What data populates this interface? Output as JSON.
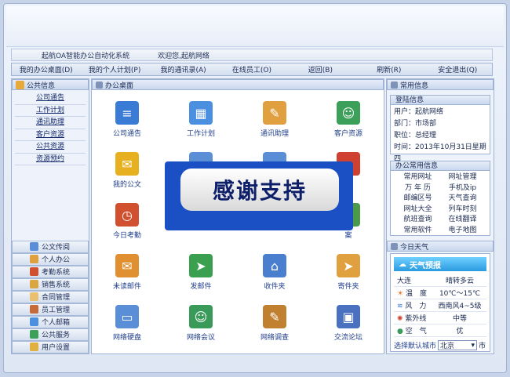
{
  "header": {
    "system_name": "起航OA智能办公自动化系统",
    "welcome": "欢迎您,起航网络"
  },
  "nav": [
    "我的办公桌面(D)",
    "我的个人计划(P)",
    "我的通讯录(A)",
    "在线员工(O)",
    "返回(B)",
    "刷新(R)",
    "安全退出(Q)"
  ],
  "left": {
    "title": "公共信息",
    "links": [
      "公司通告",
      "工作计划",
      "通讯助理",
      "客户资源",
      "公共资源",
      "资源预约"
    ],
    "modules": [
      "公文传阅",
      "个人办公",
      "考勤系统",
      "销售系统",
      "合同管理",
      "员工管理",
      "个人邮箱",
      "公共服务",
      "用户设置"
    ]
  },
  "main": {
    "title": "办公桌面",
    "icons": [
      {
        "label": "公司通告",
        "color": "#3a7bd5",
        "glyph": "≡"
      },
      {
        "label": "工作计划",
        "color": "#4a8fe0",
        "glyph": "▦"
      },
      {
        "label": "通讯助理",
        "color": "#e0a040",
        "glyph": "✎"
      },
      {
        "label": "客户资源",
        "color": "#3ca05a",
        "glyph": "☺"
      },
      {
        "label": "我的公文",
        "color": "#e6b020",
        "glyph": "✉"
      },
      {
        "label": "",
        "color": "#5a8fd8",
        "glyph": ""
      },
      {
        "label": "",
        "color": "#5a8fd8",
        "glyph": ""
      },
      {
        "label": "约",
        "color": "#d04030",
        "glyph": ""
      },
      {
        "label": "今日考勤",
        "color": "#d05030",
        "glyph": "◷"
      },
      {
        "label": "",
        "color": "#5a8fd8",
        "glyph": ""
      },
      {
        "label": "",
        "color": "#5a8fd8",
        "glyph": ""
      },
      {
        "label": "案",
        "color": "#4a9a4a",
        "glyph": ""
      },
      {
        "label": "未读邮件",
        "color": "#e09030",
        "glyph": "✉"
      },
      {
        "label": "发邮件",
        "color": "#3aa050",
        "glyph": "➤"
      },
      {
        "label": "收件夹",
        "color": "#4a7fd0",
        "glyph": "⌂"
      },
      {
        "label": "寄件夹",
        "color": "#e0a040",
        "glyph": "➤"
      },
      {
        "label": "网络硬盘",
        "color": "#5a8fd8",
        "glyph": "▭"
      },
      {
        "label": "网络会议",
        "color": "#3a9a5a",
        "glyph": "☺"
      },
      {
        "label": "网络调查",
        "color": "#c08030",
        "glyph": "✎"
      },
      {
        "label": "交流论坛",
        "color": "#4a70c0",
        "glyph": "▣"
      }
    ]
  },
  "right": {
    "title": "常用信息",
    "login": {
      "title": "登陆信息",
      "lines": [
        "用户：起航网络",
        "部门：市场部",
        "职位：总经理",
        "时间：2013年10月31日星期四"
      ]
    },
    "tools": {
      "title": "办公常用信息",
      "items": [
        "常用网址",
        "网址管理",
        "万 年 历",
        "手机及ip",
        "邮编区号",
        "天气查询",
        "网址大全",
        "列车时刻",
        "航班查询",
        "在线翻译",
        "常用软件",
        "电子地图"
      ]
    },
    "weather": {
      "title": "今日天气",
      "banner": "天气预报",
      "city": "大连",
      "condition": "晴转多云",
      "rows": [
        {
          "k": "温　度",
          "v": "10℃～15℃"
        },
        {
          "k": "风　力",
          "v": "西南风4~5级"
        },
        {
          "k": "紫外线",
          "v": "中等"
        },
        {
          "k": "空　气",
          "v": "优"
        }
      ],
      "select_label": "选择默认城市",
      "selected_city": "北京",
      "suffix": "市"
    }
  },
  "overlay": {
    "text": "感谢支持"
  }
}
